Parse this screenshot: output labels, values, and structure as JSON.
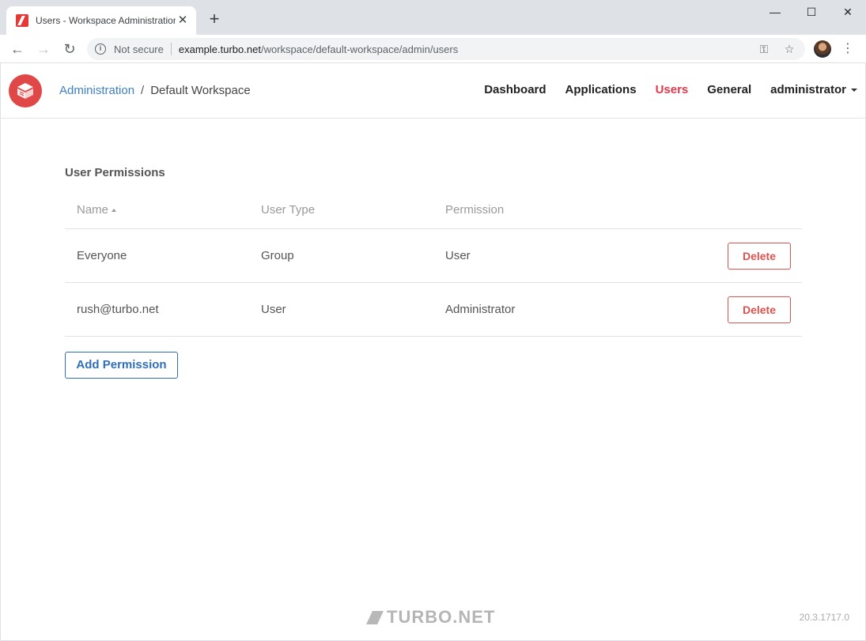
{
  "browser": {
    "tab_title": "Users - Workspace Administration",
    "tab_close": "✕",
    "new_tab": "+",
    "minimize": "—",
    "maximize": "☐",
    "close": "✕",
    "back": "←",
    "forward": "→",
    "reload": "↻",
    "security_label": "Not secure",
    "url_host": "example.turbo.net",
    "url_path": "/workspace/default-workspace/admin/users",
    "key_icon": "⚿",
    "star_icon": "☆",
    "menu_icon": "⋮"
  },
  "header": {
    "breadcrumb_link": "Administration",
    "breadcrumb_sep": "/",
    "breadcrumb_current": "Default Workspace",
    "nav": {
      "dashboard": "Dashboard",
      "applications": "Applications",
      "users": "Users",
      "general": "General",
      "user_menu": "administrator"
    }
  },
  "main": {
    "section_title": "User Permissions",
    "columns": {
      "name": "Name",
      "user_type": "User Type",
      "permission": "Permission"
    },
    "rows": [
      {
        "name": "Everyone",
        "user_type": "Group",
        "permission": "User",
        "action": "Delete"
      },
      {
        "name": "rush@turbo.net",
        "user_type": "User",
        "permission": "Administrator",
        "action": "Delete"
      }
    ],
    "add_button": "Add Permission"
  },
  "footer": {
    "brand": "TURBO.NET",
    "version": "20.3.1717.0"
  },
  "colors": {
    "accent_red": "#e0394b",
    "link_blue": "#3d7fc7",
    "button_blue": "#2e6fb7",
    "delete_red": "#d9534f"
  }
}
